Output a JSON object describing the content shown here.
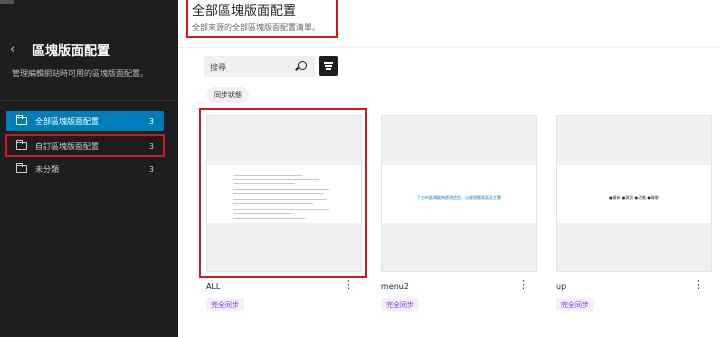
{
  "sidebar": {
    "back_icon": "chevron-left-icon",
    "title": "區塊版面配置",
    "description": "管理編輯網站時可用的區塊版面配置。",
    "items": [
      {
        "label": "全部區塊版面配置",
        "count": "3",
        "active": true
      },
      {
        "label": "自訂區塊版面配置",
        "count": "3",
        "active": false
      },
      {
        "label": "未分類",
        "count": "3",
        "active": false
      }
    ]
  },
  "header": {
    "title": "全部區塊版面配置",
    "subtitle": "全部來源的全部區塊版面配置清單。"
  },
  "search": {
    "placeholder": "搜尋"
  },
  "filter_chip": "同步狀態",
  "cards": [
    {
      "name": "ALL",
      "badge": "完全同步",
      "preview_type": "text-document"
    },
    {
      "name": "menu2",
      "badge": "完全同步",
      "preview_type": "blue-link-line",
      "preview_text": "下方的區塊能夠更改造型，以便適應版面及主題"
    },
    {
      "name": "up",
      "badge": "完全同步",
      "preview_type": "dark-link-line",
      "preview_text": "●最新 ●資訊 ●活動 ●聯繫"
    }
  ],
  "colors": {
    "sidebar_bg": "#1e1e1e",
    "accent": "#007cba",
    "highlight": "#d0191b",
    "badge_text": "#7c3aed"
  }
}
